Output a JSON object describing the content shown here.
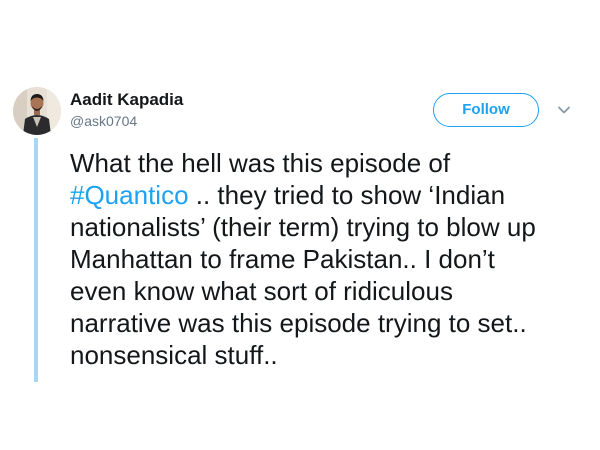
{
  "tweet": {
    "author": {
      "display_name": "Aadit Kapadia",
      "handle": "@ask0704"
    },
    "follow_label": "Follow",
    "body": {
      "line1": "What the hell was this episode of",
      "hashtag": "#Quantico",
      "line2_rest": " .. they tried to show ‘Indian",
      "line3": "nationalists’ (their term) trying to blow up",
      "line4": "Manhattan to frame Pakistan.. I don’t",
      "line5": "even know what sort of ridiculous",
      "line6": "narrative was this episode trying to set..",
      "line7": "nonsensical stuff.."
    }
  },
  "icons": {
    "more": "chevron-down-icon"
  },
  "colors": {
    "link": "#1da1f2",
    "text": "#14171a",
    "secondary_text": "#657786",
    "thread_line": "#a9d6f4"
  }
}
